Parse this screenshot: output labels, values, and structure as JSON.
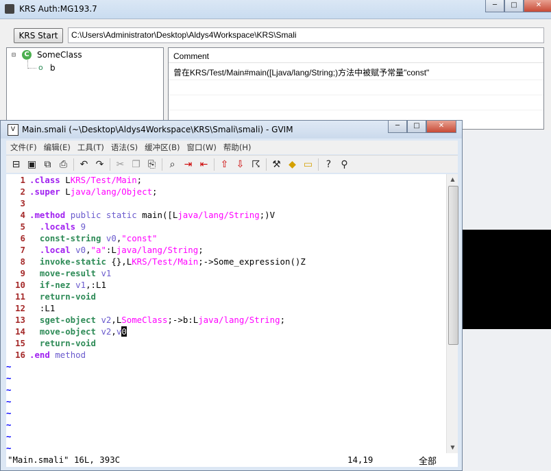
{
  "krs": {
    "title": "KRS Auth:MG193.7",
    "start_button": "KRS Start",
    "path": "C:\\Users\\Administrator\\Desktop\\Aldys4Workspace\\KRS\\Smali",
    "tree": {
      "root": "SomeClass",
      "child": "b"
    },
    "comment_header": "Comment",
    "comment_text": "曾在KRS/Test/Main#main([Ljava/lang/String;)方法中被赋予常量\"const\""
  },
  "gvim": {
    "title": "Main.smali (~\\Desktop\\Aldys4Workspace\\KRS\\Smali\\smali) - GVIM",
    "menu": [
      "文件(F)",
      "编辑(E)",
      "工具(T)",
      "语法(S)",
      "缓冲区(B)",
      "窗口(W)",
      "帮助(H)"
    ],
    "status": {
      "file": "\"Main.smali\" 16L, 393C",
      "position": "14,19",
      "scroll": "全部"
    }
  },
  "window_controls": {
    "minimize": "─",
    "maximize": "□",
    "close": "✕"
  },
  "toolbar_icons": [
    "open-icon",
    "save-icon",
    "save-all-icon",
    "print-icon",
    "undo-icon",
    "redo-icon",
    "cut-icon",
    "copy-icon",
    "paste-icon",
    "find-icon",
    "find-next-icon",
    "find-prev-icon",
    "load-session-icon",
    "save-session-icon",
    "run-script-icon",
    "make-icon",
    "shell-icon",
    "ctags-icon",
    "help-icon",
    "find-help-icon"
  ],
  "code_lines": [
    {
      "n": "1",
      "segs": [
        [
          "pp",
          ".class "
        ],
        [
          "id",
          "L"
        ],
        [
          "ty",
          "KRS/Test/Main"
        ],
        [
          "id",
          ";"
        ]
      ]
    },
    {
      "n": "2",
      "segs": [
        [
          "pp",
          ".super "
        ],
        [
          "id",
          "L"
        ],
        [
          "ty",
          "java/lang/Object"
        ],
        [
          "id",
          ";"
        ]
      ]
    },
    {
      "n": "3",
      "segs": []
    },
    {
      "n": "4",
      "segs": [
        [
          "pp",
          ".method "
        ],
        [
          "kw",
          "public static "
        ],
        [
          "id",
          "main([L"
        ],
        [
          "ty",
          "java/lang/String"
        ],
        [
          "id",
          ";)V"
        ]
      ]
    },
    {
      "n": "5",
      "segs": [
        [
          "id",
          "  "
        ],
        [
          "pp",
          ".locals "
        ],
        [
          "kw",
          "9"
        ]
      ]
    },
    {
      "n": "6",
      "segs": [
        [
          "id",
          "  "
        ],
        [
          "sa",
          "const-string "
        ],
        [
          "rr",
          "v0"
        ],
        [
          "id",
          ","
        ],
        [
          "st",
          "\"const\""
        ]
      ]
    },
    {
      "n": "7",
      "segs": [
        [
          "id",
          "  "
        ],
        [
          "pp",
          ".local "
        ],
        [
          "rr",
          "v0"
        ],
        [
          "id",
          ","
        ],
        [
          "st",
          "\"a\""
        ],
        [
          "id",
          ":L"
        ],
        [
          "ty",
          "java/lang/String"
        ],
        [
          "id",
          ";"
        ]
      ]
    },
    {
      "n": "8",
      "segs": [
        [
          "id",
          "  "
        ],
        [
          "sa",
          "invoke-static "
        ],
        [
          "id",
          "{},L"
        ],
        [
          "ty",
          "KRS/Test/Main"
        ],
        [
          "id",
          ";->Some_expression()Z"
        ]
      ]
    },
    {
      "n": "9",
      "segs": [
        [
          "id",
          "  "
        ],
        [
          "sa",
          "move-result "
        ],
        [
          "rr",
          "v1"
        ]
      ]
    },
    {
      "n": "10",
      "segs": [
        [
          "id",
          "  "
        ],
        [
          "sa",
          "if-nez "
        ],
        [
          "rr",
          "v1"
        ],
        [
          "id",
          ",:L1"
        ]
      ]
    },
    {
      "n": "11",
      "segs": [
        [
          "id",
          "  "
        ],
        [
          "sa",
          "return-void"
        ]
      ]
    },
    {
      "n": "12",
      "segs": [
        [
          "id",
          "  :L1"
        ]
      ]
    },
    {
      "n": "13",
      "segs": [
        [
          "id",
          "  "
        ],
        [
          "sa",
          "sget-object "
        ],
        [
          "rr",
          "v2"
        ],
        [
          "id",
          ",L"
        ],
        [
          "ty",
          "SomeClass"
        ],
        [
          "id",
          ";->b:L"
        ],
        [
          "ty",
          "java/lang/String"
        ],
        [
          "id",
          ";"
        ]
      ]
    },
    {
      "n": "14",
      "segs": [
        [
          "id",
          "  "
        ],
        [
          "sa",
          "move-object "
        ],
        [
          "rr",
          "v2"
        ],
        [
          "id",
          ","
        ],
        [
          "rr",
          "v"
        ],
        [
          "cursor",
          "0"
        ]
      ]
    },
    {
      "n": "15",
      "segs": [
        [
          "id",
          "  "
        ],
        [
          "sa",
          "return-void"
        ]
      ]
    },
    {
      "n": "16",
      "segs": [
        [
          "pp",
          ".end "
        ],
        [
          "kw",
          "method"
        ]
      ]
    }
  ],
  "tilde_rows": 8
}
